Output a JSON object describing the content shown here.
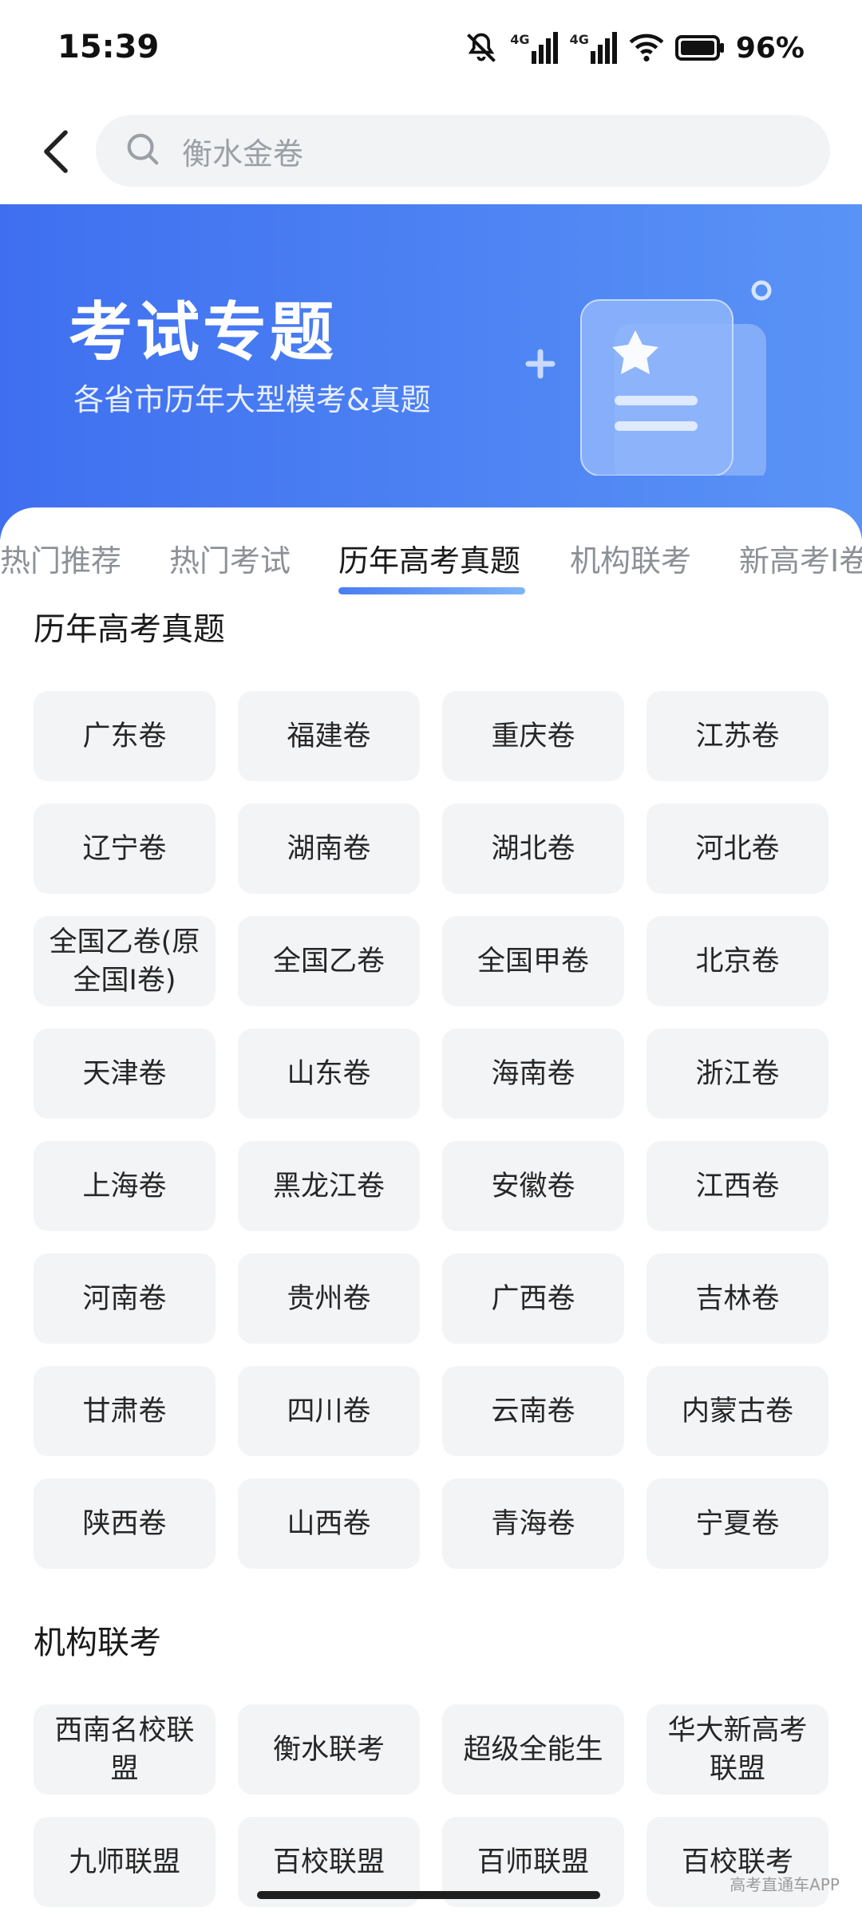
{
  "status_bar": {
    "time": "15:39",
    "network_1": "4G",
    "network_2": "4G",
    "battery_percent": "96%"
  },
  "search": {
    "placeholder": "衡水金卷"
  },
  "banner": {
    "title": "考试专题",
    "subtitle": "各省市历年大型模考&真题"
  },
  "tabs": [
    {
      "label": "热门推荐"
    },
    {
      "label": "热门考试"
    },
    {
      "label": "历年高考真题"
    },
    {
      "label": "机构联考"
    },
    {
      "label": "新高考I卷"
    }
  ],
  "active_tab": "历年高考真题",
  "sections": [
    {
      "title": "历年高考真题",
      "items": [
        "广东卷",
        "福建卷",
        "重庆卷",
        "江苏卷",
        "辽宁卷",
        "湖南卷",
        "湖北卷",
        "河北卷",
        "全国乙卷(原全国I卷)",
        "全国乙卷",
        "全国甲卷",
        "北京卷",
        "天津卷",
        "山东卷",
        "海南卷",
        "浙江卷",
        "上海卷",
        "黑龙江卷",
        "安徽卷",
        "江西卷",
        "河南卷",
        "贵州卷",
        "广西卷",
        "吉林卷",
        "甘肃卷",
        "四川卷",
        "云南卷",
        "内蒙古卷",
        "陕西卷",
        "山西卷",
        "青海卷",
        "宁夏卷"
      ]
    },
    {
      "title": "机构联考",
      "items": [
        "西南名校联盟",
        "衡水联考",
        "超级全能生",
        "华大新高考联盟",
        "九师联盟",
        "百校联盟",
        "百师联盟",
        "百校联考"
      ]
    }
  ],
  "watermark": "高考直通车APP",
  "colors": {
    "accent": "#4a7df2",
    "banner_start": "#3f6ff0",
    "banner_end": "#5a93f6",
    "chip_bg": "#f3f4f6"
  }
}
